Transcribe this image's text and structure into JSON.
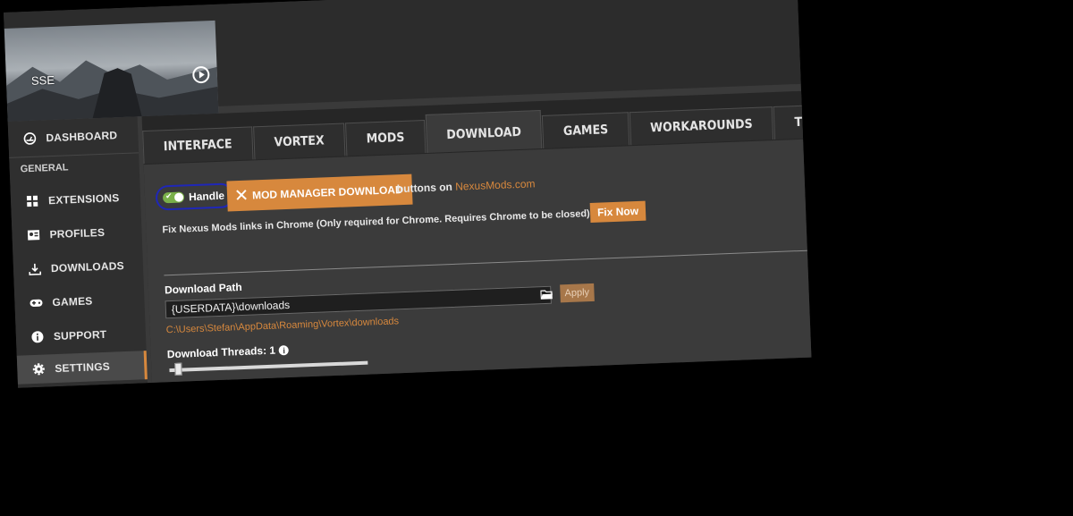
{
  "header": {
    "game_name": "SSE",
    "play_icon": "play-circle-icon"
  },
  "sidebar": {
    "items": [
      {
        "label": "DASHBOARD",
        "icon": "dashboard-icon"
      },
      {
        "label": "EXTENSIONS",
        "icon": "extensions-grid-icon"
      },
      {
        "label": "PROFILES",
        "icon": "profile-card-icon"
      },
      {
        "label": "DOWNLOADS",
        "icon": "download-icon"
      },
      {
        "label": "GAMES",
        "icon": "gamepad-icon"
      },
      {
        "label": "SUPPORT",
        "icon": "info-circle-icon"
      },
      {
        "label": "SETTINGS",
        "icon": "gear-icon",
        "active": true
      }
    ],
    "section_label": "GENERAL"
  },
  "tabs": [
    {
      "label": "INTERFACE"
    },
    {
      "label": "VORTEX"
    },
    {
      "label": "MODS"
    },
    {
      "label": "DOWNLOAD",
      "active": true
    },
    {
      "label": "GAMES"
    },
    {
      "label": "WORKAROUNDS"
    },
    {
      "label": "THEME"
    }
  ],
  "download": {
    "handle_toggle_label": "Handle",
    "handle_toggle_on": true,
    "mod_manager_button": "MOD MANAGER DOWNLOAD",
    "buttons_on_text": "buttons on ",
    "nexus_link": "NexusMods.com",
    "fix_text": "Fix Nexus Mods links in Chrome (Only required for Chrome. Requires Chrome to be closed)",
    "fix_button": "Fix Now",
    "path_label": "Download Path",
    "path_value": "{USERDATA}\\downloads",
    "apply_button": "Apply",
    "resolved_path": "C:\\Users\\Stefan\\AppData\\Roaming\\Vortex\\downloads",
    "threads_label": "Download Threads: 1",
    "threads_value": 1
  },
  "colors": {
    "accent": "#d7883d",
    "toggle_on": "#7ab04a",
    "annotation_circle": "#1f27b8"
  }
}
